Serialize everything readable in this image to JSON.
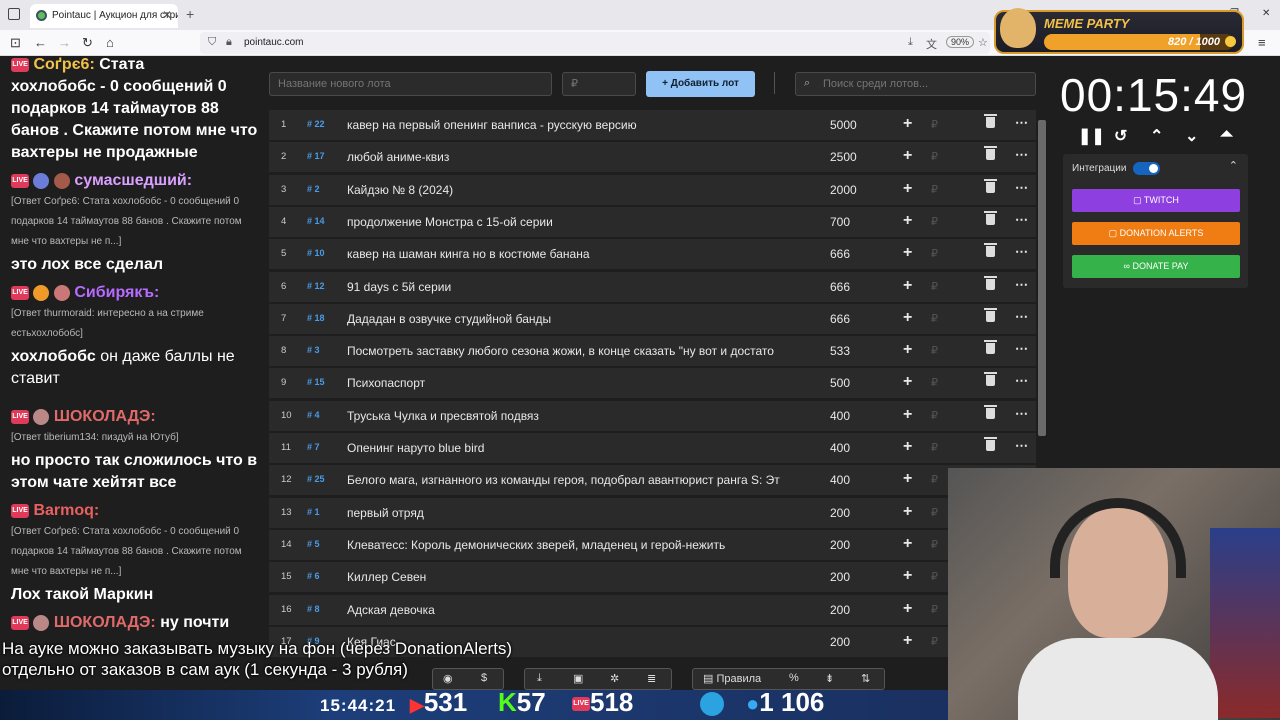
{
  "browser": {
    "tab_title": "Pointauc | Аукцион для стриме",
    "url": "pointauc.com",
    "zoom": "90%"
  },
  "meme_party": {
    "title": "MEME PARTY",
    "progress_text": "820 / 1000",
    "progress": 0.82
  },
  "chat": {
    "m1_name": "Соґрє6:",
    "m1_tail": "Стата",
    "m2_text": "хохлобобс - 0 сообщений 0 подарков 14 таймаутов 88 банов . Скажите потом мне что вахтеры не продажные",
    "m3_name": "сумасшедший:",
    "m3_reply": "[Ответ Соґрє6: Стата хохлобобс - 0 сообщений 0 подарков 14 таймаутов 88 банов . Скажите потом мне что вахтеры не п...]",
    "m4_text": "это лох все сделал",
    "m5_name": "Сибирякъ:",
    "m5_reply": "[Ответ thurmoraid: интересно а на стриме естьхохлобобс]",
    "m6_name": "хохлобобс",
    "m6_text": "он даже баллы не ставит",
    "m7_name": "ШОКОЛАДЭ:",
    "m7_reply": "[Ответ tiberium134: пиздуй на Ютуб]",
    "m8_text": "но просто так сложилось что в этом чате хейтят все",
    "m9_name": "Barmoq:",
    "m9_reply": "[Ответ Соґрє6: Стата хохлобобс - 0 сообщений 0 подарков 14 таймаутов 88 банов . Скажите потом мне что вахтеры не п...]",
    "m10_text": "Лох такой Маркин",
    "m11_name": "ШОКОЛАДЭ:",
    "m11_text": "ну почти"
  },
  "toolbar": {
    "new_lot_placeholder": "Название нового лота",
    "amount_placeholder": "₽",
    "add_lot_label": "Добавить лот",
    "search_placeholder": "Поиск среди лотов..."
  },
  "lots": [
    {
      "n": "1",
      "id": "22",
      "name": "кавер на первый опенинг ванписа - русскую версию",
      "amount": "5000"
    },
    {
      "n": "2",
      "id": "17",
      "name": "любой аниме-квиз",
      "amount": "2500"
    },
    {
      "n": "3",
      "id": "2",
      "name": "Кайдзю № 8 (2024)",
      "amount": "2000"
    },
    {
      "n": "4",
      "id": "14",
      "name": "продолжение Монстра с 15-ой серии",
      "amount": "700"
    },
    {
      "n": "5",
      "id": "10",
      "name": "кавер на шаман кинга но в костюме банана",
      "amount": "666"
    },
    {
      "n": "6",
      "id": "12",
      "name": "91 days с 5й серии",
      "amount": "666"
    },
    {
      "n": "7",
      "id": "18",
      "name": "Дададан в озвучке студийной банды",
      "amount": "666"
    },
    {
      "n": "8",
      "id": "3",
      "name": "Посмотреть заставку любого сезона жожи, в конце сказать \"ну вот и достато",
      "amount": "533"
    },
    {
      "n": "9",
      "id": "15",
      "name": "Психопаспорт",
      "amount": "500"
    },
    {
      "n": "10",
      "id": "4",
      "name": "Труська Чулка и пресвятой подвяз",
      "amount": "400"
    },
    {
      "n": "11",
      "id": "7",
      "name": "Опенинг наруто blue bird",
      "amount": "400"
    },
    {
      "n": "12",
      "id": "25",
      "name": "Белого мага, изгнанного из команды героя, подобрал авантюрист ранга S: Эт",
      "amount": "400"
    },
    {
      "n": "13",
      "id": "1",
      "name": "первый отряд",
      "amount": "200"
    },
    {
      "n": "14",
      "id": "5",
      "name": "Клеватесс: Король демонических зверей, младенец и герой-нежить",
      "amount": "200"
    },
    {
      "n": "15",
      "id": "6",
      "name": "Киллер Севен",
      "amount": "200"
    },
    {
      "n": "16",
      "id": "8",
      "name": "Адская девочка",
      "amount": "200"
    },
    {
      "n": "17",
      "id": "9",
      "name": "Кея Гиас",
      "amount": "200"
    }
  ],
  "timer": {
    "value": "00:15:49"
  },
  "integrations": {
    "label": "Интеграции",
    "twitch": "TWITCH",
    "donation_alerts": "DONATION ALERTS",
    "donate_pay": "DONATE PAY",
    "colors": {
      "twitch": "#8e3fe0",
      "donation_alerts": "#f07d13",
      "donate_pay": "#36b24b",
      "add": "#90c2f5"
    }
  },
  "bottom_toolbar": {
    "rules_label": "Правила",
    "percent": "%"
  },
  "overlay": {
    "line1": "На ауке можно заказывать музыку на фон (через DonationAlerts)",
    "line2": "отдельно от заказов в сам аук (1 секунда - 3 рубля)"
  },
  "stream": {
    "clock": "15:44:21",
    "youtube": "531",
    "kick": "57",
    "vk": "518",
    "viewers": "1 106"
  }
}
